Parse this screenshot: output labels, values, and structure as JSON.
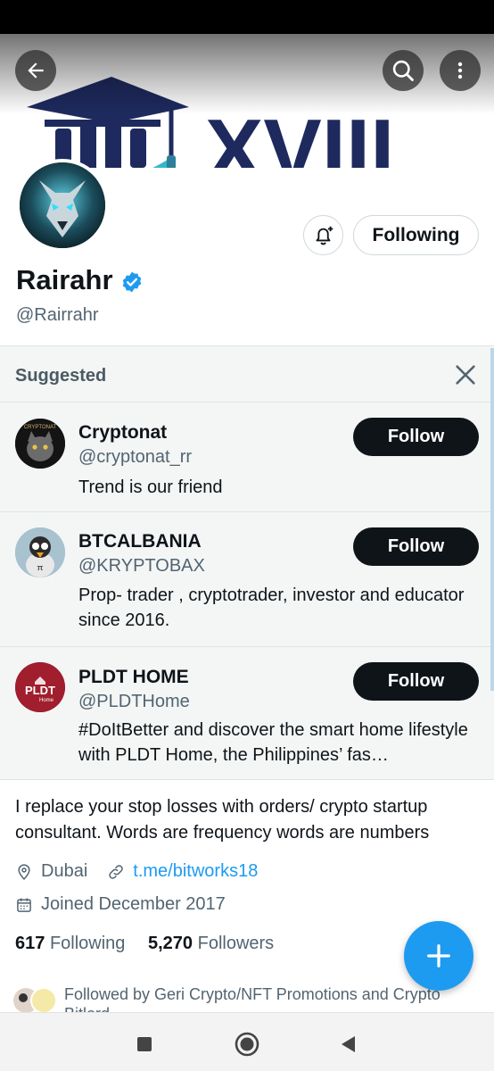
{
  "header": {
    "back_icon": "arrow-left-icon",
    "search_icon": "search-icon",
    "more_icon": "more-vertical-icon",
    "banner_logo_text": "XVIII"
  },
  "profile": {
    "display_name": "Rairahr",
    "handle": "@Rairrahr",
    "verified": true,
    "following_button_label": "Following",
    "notify_icon": "bell-plus-icon",
    "bio": "I replace your stop losses with orders/ crypto startup consultant. Words are frequency words are numbers",
    "location": "Dubai",
    "website": "t.me/bitworks18",
    "joined": "Joined December 2017",
    "following_count": "617",
    "following_label": "Following",
    "followers_count": "5,270",
    "followers_label": "Followers",
    "followed_by": "Followed by Geri Crypto/NFT Promotions and Crypto Bitlord"
  },
  "suggested": {
    "title": "Suggested",
    "items": [
      {
        "name": "Cryptonat",
        "handle": "@cryptonat_rr",
        "bio": "Trend is our friend",
        "button": "Follow",
        "avatar_label": "CRYPTONAT"
      },
      {
        "name": "BTCALBANIA",
        "handle": "@KRYPTOBAX",
        "bio": "Prop- trader , cryptotrader, investor and educator since 2016.",
        "button": "Follow"
      },
      {
        "name": "PLDT HOME",
        "handle": "@PLDTHome",
        "bio": "#DoItBetter and discover the smart home lifestyle with PLDT Home, the Philippines’ fas…",
        "button": "Follow",
        "avatar_label": "PLDT",
        "avatar_sub": "Home"
      }
    ]
  },
  "colors": {
    "accent": "#1d9bf0",
    "text_primary": "#0f1419",
    "text_secondary": "#536471",
    "button_dark": "#0f1419",
    "banner_navy": "#1e2a5e",
    "banner_teal": "#34b7c9"
  },
  "nav": {
    "recent_icon": "square-recents-icon",
    "home_icon": "circle-home-icon",
    "back_icon": "triangle-back-icon"
  },
  "fab_icon": "plus-icon"
}
